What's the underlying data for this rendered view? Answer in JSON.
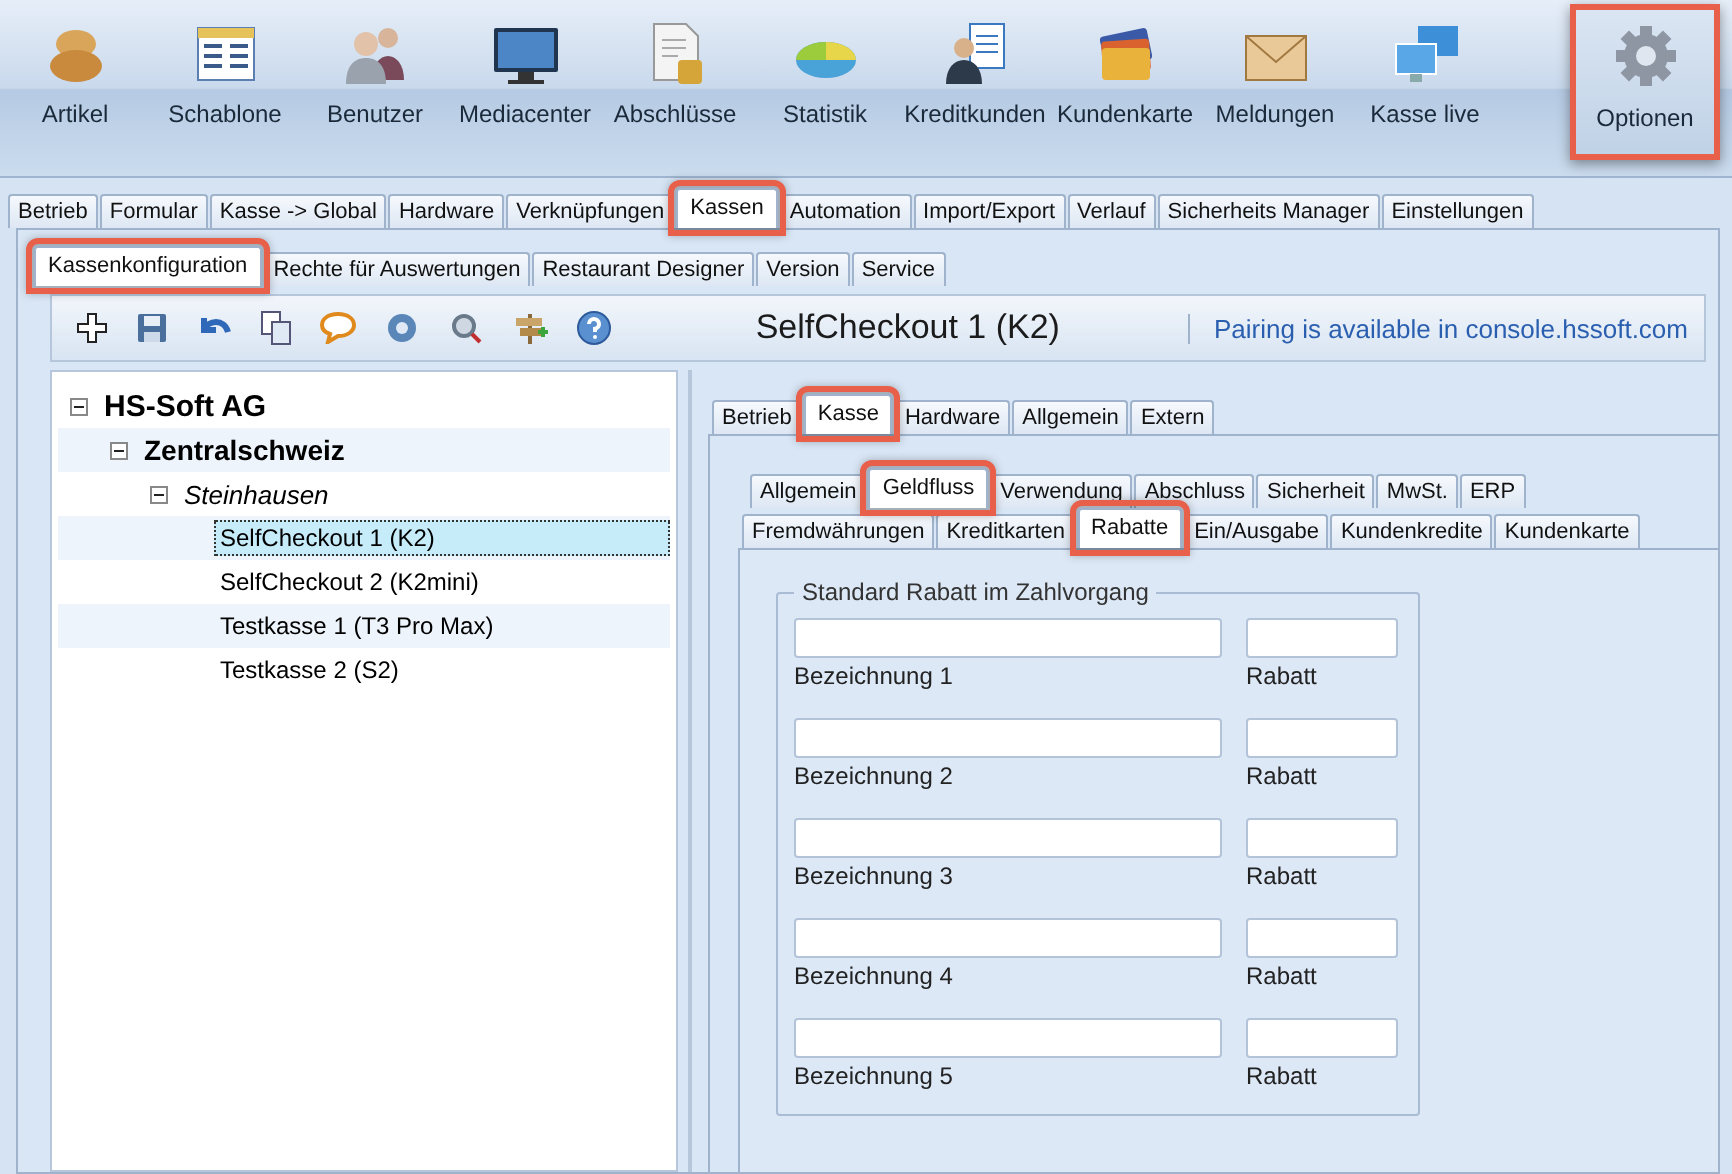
{
  "toolbar": [
    {
      "label": "Artikel",
      "highlighted": false
    },
    {
      "label": "Schablone",
      "highlighted": false
    },
    {
      "label": "Benutzer",
      "highlighted": false
    },
    {
      "label": "Mediacenter",
      "highlighted": false
    },
    {
      "label": "Abschlüsse",
      "highlighted": false
    },
    {
      "label": "Statistik",
      "highlighted": false
    },
    {
      "label": "Kreditkunden",
      "highlighted": false
    },
    {
      "label": "Kundenkarte",
      "highlighted": false
    },
    {
      "label": "Meldungen",
      "highlighted": false
    },
    {
      "label": "Kasse live",
      "highlighted": false
    },
    {
      "label": "Optionen",
      "highlighted": true
    }
  ],
  "main_tabs": [
    {
      "label": "Betrieb",
      "selected": false,
      "highlighted": false
    },
    {
      "label": "Formular",
      "selected": false,
      "highlighted": false
    },
    {
      "label": "Kasse -> Global",
      "selected": false,
      "highlighted": false
    },
    {
      "label": "Hardware",
      "selected": false,
      "highlighted": false
    },
    {
      "label": "Verknüpfungen",
      "selected": false,
      "highlighted": false
    },
    {
      "label": "Kassen",
      "selected": true,
      "highlighted": true
    },
    {
      "label": "Automation",
      "selected": false,
      "highlighted": false
    },
    {
      "label": "Import/Export",
      "selected": false,
      "highlighted": false
    },
    {
      "label": "Verlauf",
      "selected": false,
      "highlighted": false
    },
    {
      "label": "Sicherheits Manager",
      "selected": false,
      "highlighted": false
    },
    {
      "label": "Einstellungen",
      "selected": false,
      "highlighted": false
    }
  ],
  "sub_tabs": [
    {
      "label": "Kassenkonfiguration",
      "selected": true,
      "highlighted": true
    },
    {
      "label": "Rechte für Auswertungen",
      "selected": false,
      "highlighted": false
    },
    {
      "label": "Restaurant Designer",
      "selected": false,
      "highlighted": false
    },
    {
      "label": "Version",
      "selected": false,
      "highlighted": false
    },
    {
      "label": "Service",
      "selected": false,
      "highlighted": false
    }
  ],
  "title": "SelfCheckout 1 (K2)",
  "pairing_note": "Pairing is available in console.hssoft.com",
  "tree": [
    {
      "label": "HS-Soft AG",
      "expanded": true,
      "selected": false,
      "children": [
        {
          "label": "Zentralschweiz",
          "expanded": true,
          "selected": false,
          "children": [
            {
              "label": "Steinhausen",
              "expanded": true,
              "selected": false,
              "children": [
                {
                  "label": "SelfCheckout 1 (K2)",
                  "selected": true
                },
                {
                  "label": "SelfCheckout 2 (K2mini)",
                  "selected": false
                },
                {
                  "label": "Testkasse 1 (T3 Pro Max)",
                  "selected": false
                },
                {
                  "label": "Testkasse 2 (S2)",
                  "selected": false
                }
              ]
            }
          ]
        }
      ]
    }
  ],
  "device_tabs": [
    {
      "label": "Betrieb",
      "selected": false,
      "highlighted": false
    },
    {
      "label": "Kasse",
      "selected": true,
      "highlighted": true
    },
    {
      "label": "Hardware",
      "selected": false,
      "highlighted": false
    },
    {
      "label": "Allgemein",
      "selected": false,
      "highlighted": false
    },
    {
      "label": "Extern",
      "selected": false,
      "highlighted": false
    }
  ],
  "section_tabs": [
    {
      "label": "Allgemein",
      "selected": false,
      "highlighted": false
    },
    {
      "label": "Geldfluss",
      "selected": true,
      "highlighted": true
    },
    {
      "label": "Verwendung",
      "selected": false,
      "highlighted": false
    },
    {
      "label": "Abschluss",
      "selected": false,
      "highlighted": false
    },
    {
      "label": "Sicherheit",
      "selected": false,
      "highlighted": false
    },
    {
      "label": "MwSt.",
      "selected": false,
      "highlighted": false
    },
    {
      "label": "ERP",
      "selected": false,
      "highlighted": false
    }
  ],
  "page_tabs": [
    {
      "label": "Fremdwährungen",
      "selected": false,
      "highlighted": false
    },
    {
      "label": "Kreditkarten",
      "selected": false,
      "highlighted": false
    },
    {
      "label": "Rabatte",
      "selected": true,
      "highlighted": true
    },
    {
      "label": "Ein/Ausgabe",
      "selected": false,
      "highlighted": false
    },
    {
      "label": "Kundenkredite",
      "selected": false,
      "highlighted": false
    },
    {
      "label": "Kundenkarte",
      "selected": false,
      "highlighted": false
    }
  ],
  "group": {
    "title": "Standard Rabatt im Zahlvorgang",
    "rows": [
      {
        "name_label": "Bezeichnung 1",
        "discount_label": "Rabatt"
      },
      {
        "name_label": "Bezeichnung 2",
        "discount_label": "Rabatt"
      },
      {
        "name_label": "Bezeichnung 3",
        "discount_label": "Rabatt"
      },
      {
        "name_label": "Bezeichnung 4",
        "discount_label": "Rabatt"
      },
      {
        "name_label": "Bezeichnung 5",
        "discount_label": "Rabatt"
      }
    ]
  }
}
